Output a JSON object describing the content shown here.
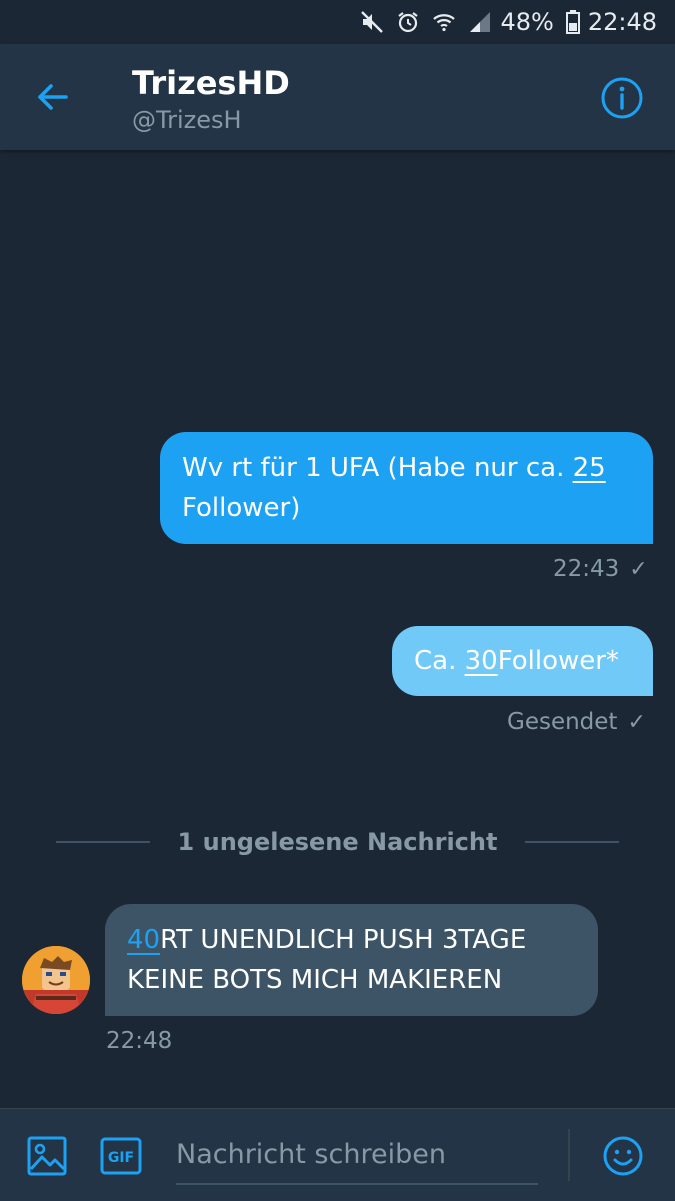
{
  "statusbar": {
    "battery": "48%",
    "time": "22:48",
    "icons": [
      "mute-icon",
      "alarm-icon",
      "wifi-icon",
      "signal-icon",
      "battery-icon"
    ]
  },
  "header": {
    "title": "TrizesHD",
    "handle": "@TrizesH",
    "back_icon": "back-arrow-icon",
    "info_icon": "info-icon"
  },
  "messages": [
    {
      "direction": "outgoing",
      "text_before": "Wv rt für 1 UFA (Habe nur ca. ",
      "text_underlined": "25",
      "text_after": "Follower)",
      "meta": "22:43"
    },
    {
      "direction": "outgoing",
      "text_before": "Ca. ",
      "text_underlined": "30",
      "text_after": "Follower*",
      "meta": "Gesendet"
    },
    {
      "direction": "incoming",
      "text_link": "40",
      "text_after": "RT UNENDLICH PUSH 3TAGE KEINE BOTS MICH MAKIEREN",
      "meta": "22:48"
    }
  ],
  "unread_divider": "1 ungelesene Nachricht",
  "composer": {
    "placeholder": "Nachricht schreiben",
    "gif_label": "GIF",
    "icons": [
      "image-icon",
      "gif-icon",
      "emoji-icon"
    ]
  },
  "colors": {
    "background": "#1b2735",
    "header": "#243447",
    "accent": "#1da1f2",
    "outgoing_light": "#71c9f8",
    "incoming": "#3d5466",
    "muted": "#8899a6"
  }
}
